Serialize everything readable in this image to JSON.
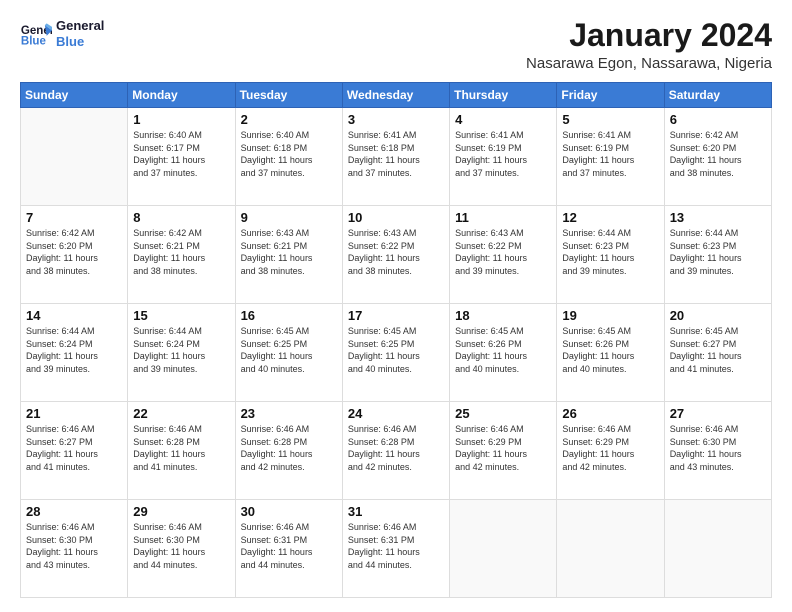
{
  "logo": {
    "text_general": "General",
    "text_blue": "Blue"
  },
  "header": {
    "month_title": "January 2024",
    "location": "Nasarawa Egon, Nassarawa, Nigeria"
  },
  "days_of_week": [
    "Sunday",
    "Monday",
    "Tuesday",
    "Wednesday",
    "Thursday",
    "Friday",
    "Saturday"
  ],
  "weeks": [
    [
      {
        "day": "",
        "info": ""
      },
      {
        "day": "1",
        "info": "Sunrise: 6:40 AM\nSunset: 6:17 PM\nDaylight: 11 hours\nand 37 minutes."
      },
      {
        "day": "2",
        "info": "Sunrise: 6:40 AM\nSunset: 6:18 PM\nDaylight: 11 hours\nand 37 minutes."
      },
      {
        "day": "3",
        "info": "Sunrise: 6:41 AM\nSunset: 6:18 PM\nDaylight: 11 hours\nand 37 minutes."
      },
      {
        "day": "4",
        "info": "Sunrise: 6:41 AM\nSunset: 6:19 PM\nDaylight: 11 hours\nand 37 minutes."
      },
      {
        "day": "5",
        "info": "Sunrise: 6:41 AM\nSunset: 6:19 PM\nDaylight: 11 hours\nand 37 minutes."
      },
      {
        "day": "6",
        "info": "Sunrise: 6:42 AM\nSunset: 6:20 PM\nDaylight: 11 hours\nand 38 minutes."
      }
    ],
    [
      {
        "day": "7",
        "info": "Sunrise: 6:42 AM\nSunset: 6:20 PM\nDaylight: 11 hours\nand 38 minutes."
      },
      {
        "day": "8",
        "info": "Sunrise: 6:42 AM\nSunset: 6:21 PM\nDaylight: 11 hours\nand 38 minutes."
      },
      {
        "day": "9",
        "info": "Sunrise: 6:43 AM\nSunset: 6:21 PM\nDaylight: 11 hours\nand 38 minutes."
      },
      {
        "day": "10",
        "info": "Sunrise: 6:43 AM\nSunset: 6:22 PM\nDaylight: 11 hours\nand 38 minutes."
      },
      {
        "day": "11",
        "info": "Sunrise: 6:43 AM\nSunset: 6:22 PM\nDaylight: 11 hours\nand 39 minutes."
      },
      {
        "day": "12",
        "info": "Sunrise: 6:44 AM\nSunset: 6:23 PM\nDaylight: 11 hours\nand 39 minutes."
      },
      {
        "day": "13",
        "info": "Sunrise: 6:44 AM\nSunset: 6:23 PM\nDaylight: 11 hours\nand 39 minutes."
      }
    ],
    [
      {
        "day": "14",
        "info": "Sunrise: 6:44 AM\nSunset: 6:24 PM\nDaylight: 11 hours\nand 39 minutes."
      },
      {
        "day": "15",
        "info": "Sunrise: 6:44 AM\nSunset: 6:24 PM\nDaylight: 11 hours\nand 39 minutes."
      },
      {
        "day": "16",
        "info": "Sunrise: 6:45 AM\nSunset: 6:25 PM\nDaylight: 11 hours\nand 40 minutes."
      },
      {
        "day": "17",
        "info": "Sunrise: 6:45 AM\nSunset: 6:25 PM\nDaylight: 11 hours\nand 40 minutes."
      },
      {
        "day": "18",
        "info": "Sunrise: 6:45 AM\nSunset: 6:26 PM\nDaylight: 11 hours\nand 40 minutes."
      },
      {
        "day": "19",
        "info": "Sunrise: 6:45 AM\nSunset: 6:26 PM\nDaylight: 11 hours\nand 40 minutes."
      },
      {
        "day": "20",
        "info": "Sunrise: 6:45 AM\nSunset: 6:27 PM\nDaylight: 11 hours\nand 41 minutes."
      }
    ],
    [
      {
        "day": "21",
        "info": "Sunrise: 6:46 AM\nSunset: 6:27 PM\nDaylight: 11 hours\nand 41 minutes."
      },
      {
        "day": "22",
        "info": "Sunrise: 6:46 AM\nSunset: 6:28 PM\nDaylight: 11 hours\nand 41 minutes."
      },
      {
        "day": "23",
        "info": "Sunrise: 6:46 AM\nSunset: 6:28 PM\nDaylight: 11 hours\nand 42 minutes."
      },
      {
        "day": "24",
        "info": "Sunrise: 6:46 AM\nSunset: 6:28 PM\nDaylight: 11 hours\nand 42 minutes."
      },
      {
        "day": "25",
        "info": "Sunrise: 6:46 AM\nSunset: 6:29 PM\nDaylight: 11 hours\nand 42 minutes."
      },
      {
        "day": "26",
        "info": "Sunrise: 6:46 AM\nSunset: 6:29 PM\nDaylight: 11 hours\nand 42 minutes."
      },
      {
        "day": "27",
        "info": "Sunrise: 6:46 AM\nSunset: 6:30 PM\nDaylight: 11 hours\nand 43 minutes."
      }
    ],
    [
      {
        "day": "28",
        "info": "Sunrise: 6:46 AM\nSunset: 6:30 PM\nDaylight: 11 hours\nand 43 minutes."
      },
      {
        "day": "29",
        "info": "Sunrise: 6:46 AM\nSunset: 6:30 PM\nDaylight: 11 hours\nand 44 minutes."
      },
      {
        "day": "30",
        "info": "Sunrise: 6:46 AM\nSunset: 6:31 PM\nDaylight: 11 hours\nand 44 minutes."
      },
      {
        "day": "31",
        "info": "Sunrise: 6:46 AM\nSunset: 6:31 PM\nDaylight: 11 hours\nand 44 minutes."
      },
      {
        "day": "",
        "info": ""
      },
      {
        "day": "",
        "info": ""
      },
      {
        "day": "",
        "info": ""
      }
    ]
  ]
}
